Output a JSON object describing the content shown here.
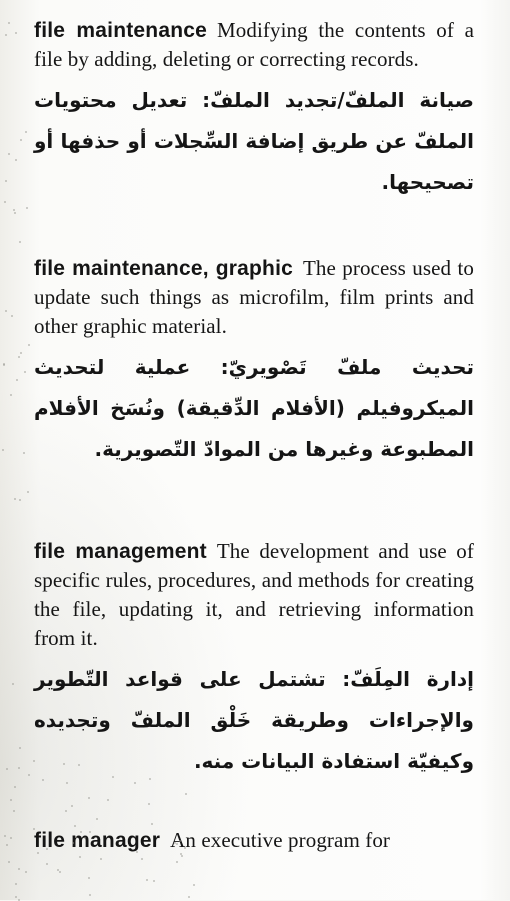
{
  "entries": [
    {
      "term": "file maintenance",
      "definition": "Modifying the contents of a file by adding, deleting or correcting records.",
      "arabic": "صيانة الملفّ/تجديد الملفّ: تعديل محتويات الملفّ عن طريق إضافة السِّجلات أو حذفها أو تصحيحها."
    },
    {
      "term": "file maintenance, graphic",
      "definition": "The process used to update such things as microfilm, film prints and other graphic material.",
      "arabic": "تحديث ملفّ تَصْويريّ: عملية لتحديث الميكروفيلم (الأفلام الدِّقيقة) ونُسَخ الأفلام المطبوعة وغيرها من الموادّ التّصويرية."
    },
    {
      "term": "file management",
      "definition": "The development and use of specific rules, procedures, and methods for creating the file, updating it, and retrieving information from it.",
      "arabic": "إدارة المِلَفّ: تشتمل على قواعد التّطوير والإجراءات وطريقة خَلْق الملفّ وتجديده وكيفيّة استفادة البيانات منه."
    },
    {
      "term": "file manager",
      "definition": "An executive program for"
    }
  ]
}
